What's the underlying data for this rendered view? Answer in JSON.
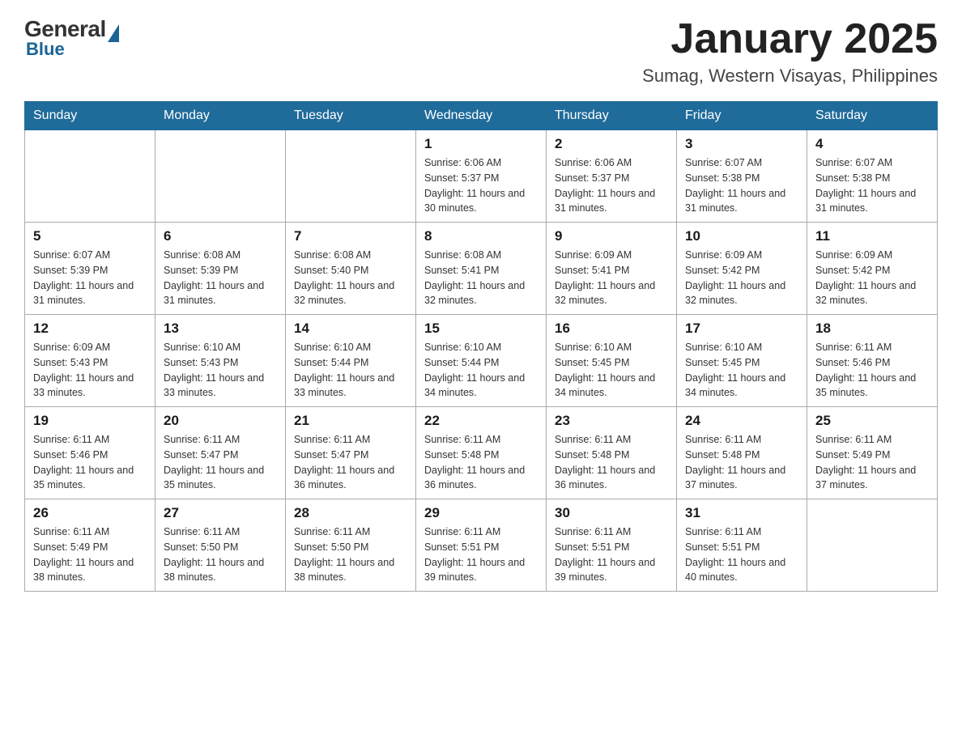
{
  "logo": {
    "general": "General",
    "blue": "Blue"
  },
  "header": {
    "month": "January 2025",
    "location": "Sumag, Western Visayas, Philippines"
  },
  "days_of_week": [
    "Sunday",
    "Monday",
    "Tuesday",
    "Wednesday",
    "Thursday",
    "Friday",
    "Saturday"
  ],
  "weeks": [
    [
      {
        "day": "",
        "sunrise": "",
        "sunset": "",
        "daylight": ""
      },
      {
        "day": "",
        "sunrise": "",
        "sunset": "",
        "daylight": ""
      },
      {
        "day": "",
        "sunrise": "",
        "sunset": "",
        "daylight": ""
      },
      {
        "day": "1",
        "sunrise": "Sunrise: 6:06 AM",
        "sunset": "Sunset: 5:37 PM",
        "daylight": "Daylight: 11 hours and 30 minutes."
      },
      {
        "day": "2",
        "sunrise": "Sunrise: 6:06 AM",
        "sunset": "Sunset: 5:37 PM",
        "daylight": "Daylight: 11 hours and 31 minutes."
      },
      {
        "day": "3",
        "sunrise": "Sunrise: 6:07 AM",
        "sunset": "Sunset: 5:38 PM",
        "daylight": "Daylight: 11 hours and 31 minutes."
      },
      {
        "day": "4",
        "sunrise": "Sunrise: 6:07 AM",
        "sunset": "Sunset: 5:38 PM",
        "daylight": "Daylight: 11 hours and 31 minutes."
      }
    ],
    [
      {
        "day": "5",
        "sunrise": "Sunrise: 6:07 AM",
        "sunset": "Sunset: 5:39 PM",
        "daylight": "Daylight: 11 hours and 31 minutes."
      },
      {
        "day": "6",
        "sunrise": "Sunrise: 6:08 AM",
        "sunset": "Sunset: 5:39 PM",
        "daylight": "Daylight: 11 hours and 31 minutes."
      },
      {
        "day": "7",
        "sunrise": "Sunrise: 6:08 AM",
        "sunset": "Sunset: 5:40 PM",
        "daylight": "Daylight: 11 hours and 32 minutes."
      },
      {
        "day": "8",
        "sunrise": "Sunrise: 6:08 AM",
        "sunset": "Sunset: 5:41 PM",
        "daylight": "Daylight: 11 hours and 32 minutes."
      },
      {
        "day": "9",
        "sunrise": "Sunrise: 6:09 AM",
        "sunset": "Sunset: 5:41 PM",
        "daylight": "Daylight: 11 hours and 32 minutes."
      },
      {
        "day": "10",
        "sunrise": "Sunrise: 6:09 AM",
        "sunset": "Sunset: 5:42 PM",
        "daylight": "Daylight: 11 hours and 32 minutes."
      },
      {
        "day": "11",
        "sunrise": "Sunrise: 6:09 AM",
        "sunset": "Sunset: 5:42 PM",
        "daylight": "Daylight: 11 hours and 32 minutes."
      }
    ],
    [
      {
        "day": "12",
        "sunrise": "Sunrise: 6:09 AM",
        "sunset": "Sunset: 5:43 PM",
        "daylight": "Daylight: 11 hours and 33 minutes."
      },
      {
        "day": "13",
        "sunrise": "Sunrise: 6:10 AM",
        "sunset": "Sunset: 5:43 PM",
        "daylight": "Daylight: 11 hours and 33 minutes."
      },
      {
        "day": "14",
        "sunrise": "Sunrise: 6:10 AM",
        "sunset": "Sunset: 5:44 PM",
        "daylight": "Daylight: 11 hours and 33 minutes."
      },
      {
        "day": "15",
        "sunrise": "Sunrise: 6:10 AM",
        "sunset": "Sunset: 5:44 PM",
        "daylight": "Daylight: 11 hours and 34 minutes."
      },
      {
        "day": "16",
        "sunrise": "Sunrise: 6:10 AM",
        "sunset": "Sunset: 5:45 PM",
        "daylight": "Daylight: 11 hours and 34 minutes."
      },
      {
        "day": "17",
        "sunrise": "Sunrise: 6:10 AM",
        "sunset": "Sunset: 5:45 PM",
        "daylight": "Daylight: 11 hours and 34 minutes."
      },
      {
        "day": "18",
        "sunrise": "Sunrise: 6:11 AM",
        "sunset": "Sunset: 5:46 PM",
        "daylight": "Daylight: 11 hours and 35 minutes."
      }
    ],
    [
      {
        "day": "19",
        "sunrise": "Sunrise: 6:11 AM",
        "sunset": "Sunset: 5:46 PM",
        "daylight": "Daylight: 11 hours and 35 minutes."
      },
      {
        "day": "20",
        "sunrise": "Sunrise: 6:11 AM",
        "sunset": "Sunset: 5:47 PM",
        "daylight": "Daylight: 11 hours and 35 minutes."
      },
      {
        "day": "21",
        "sunrise": "Sunrise: 6:11 AM",
        "sunset": "Sunset: 5:47 PM",
        "daylight": "Daylight: 11 hours and 36 minutes."
      },
      {
        "day": "22",
        "sunrise": "Sunrise: 6:11 AM",
        "sunset": "Sunset: 5:48 PM",
        "daylight": "Daylight: 11 hours and 36 minutes."
      },
      {
        "day": "23",
        "sunrise": "Sunrise: 6:11 AM",
        "sunset": "Sunset: 5:48 PM",
        "daylight": "Daylight: 11 hours and 36 minutes."
      },
      {
        "day": "24",
        "sunrise": "Sunrise: 6:11 AM",
        "sunset": "Sunset: 5:48 PM",
        "daylight": "Daylight: 11 hours and 37 minutes."
      },
      {
        "day": "25",
        "sunrise": "Sunrise: 6:11 AM",
        "sunset": "Sunset: 5:49 PM",
        "daylight": "Daylight: 11 hours and 37 minutes."
      }
    ],
    [
      {
        "day": "26",
        "sunrise": "Sunrise: 6:11 AM",
        "sunset": "Sunset: 5:49 PM",
        "daylight": "Daylight: 11 hours and 38 minutes."
      },
      {
        "day": "27",
        "sunrise": "Sunrise: 6:11 AM",
        "sunset": "Sunset: 5:50 PM",
        "daylight": "Daylight: 11 hours and 38 minutes."
      },
      {
        "day": "28",
        "sunrise": "Sunrise: 6:11 AM",
        "sunset": "Sunset: 5:50 PM",
        "daylight": "Daylight: 11 hours and 38 minutes."
      },
      {
        "day": "29",
        "sunrise": "Sunrise: 6:11 AM",
        "sunset": "Sunset: 5:51 PM",
        "daylight": "Daylight: 11 hours and 39 minutes."
      },
      {
        "day": "30",
        "sunrise": "Sunrise: 6:11 AM",
        "sunset": "Sunset: 5:51 PM",
        "daylight": "Daylight: 11 hours and 39 minutes."
      },
      {
        "day": "31",
        "sunrise": "Sunrise: 6:11 AM",
        "sunset": "Sunset: 5:51 PM",
        "daylight": "Daylight: 11 hours and 40 minutes."
      },
      {
        "day": "",
        "sunrise": "",
        "sunset": "",
        "daylight": ""
      }
    ]
  ]
}
